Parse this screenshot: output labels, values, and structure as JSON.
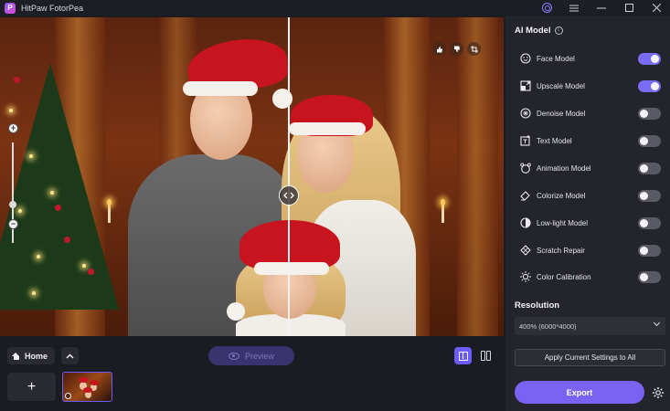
{
  "titlebar": {
    "app_name": "HitPaw FotorPea",
    "logo_letter": "P",
    "icons": [
      "account-icon",
      "menu-icon",
      "minimize-icon",
      "maximize-icon",
      "close-icon"
    ]
  },
  "panel": {
    "title": "AI Model",
    "info_glyph": "i",
    "models": [
      {
        "label": "Face Model",
        "icon": "face-icon",
        "enabled": true
      },
      {
        "label": "Upscale Model",
        "icon": "upscale-icon",
        "enabled": true
      },
      {
        "label": "Denoise Model",
        "icon": "denoise-icon",
        "enabled": false
      },
      {
        "label": "Text Model",
        "icon": "text-icon",
        "enabled": false
      },
      {
        "label": "Animation Model",
        "icon": "animation-icon",
        "enabled": false
      },
      {
        "label": "Colorize Model",
        "icon": "colorize-icon",
        "enabled": false
      },
      {
        "label": "Low-light Model",
        "icon": "low-light-icon",
        "enabled": false
      },
      {
        "label": "Scratch Repair",
        "icon": "scratch-icon",
        "enabled": false
      },
      {
        "label": "Color Calibration",
        "icon": "calibration-icon",
        "enabled": false
      }
    ],
    "resolution_title": "Resolution",
    "resolution_value": "400% (6000*4000)",
    "apply_label": "Apply Current Settings to All",
    "export_label": "Export"
  },
  "bottom": {
    "home_label": "Home",
    "preview_label": "Preview",
    "add_glyph": "+"
  },
  "colors": {
    "accent": "#7a63f2",
    "toggle_on": "#7b6cf5",
    "toggle_off": "#5a5a64",
    "panel_bg": "#24242c",
    "app_bg": "#1b1b22"
  }
}
